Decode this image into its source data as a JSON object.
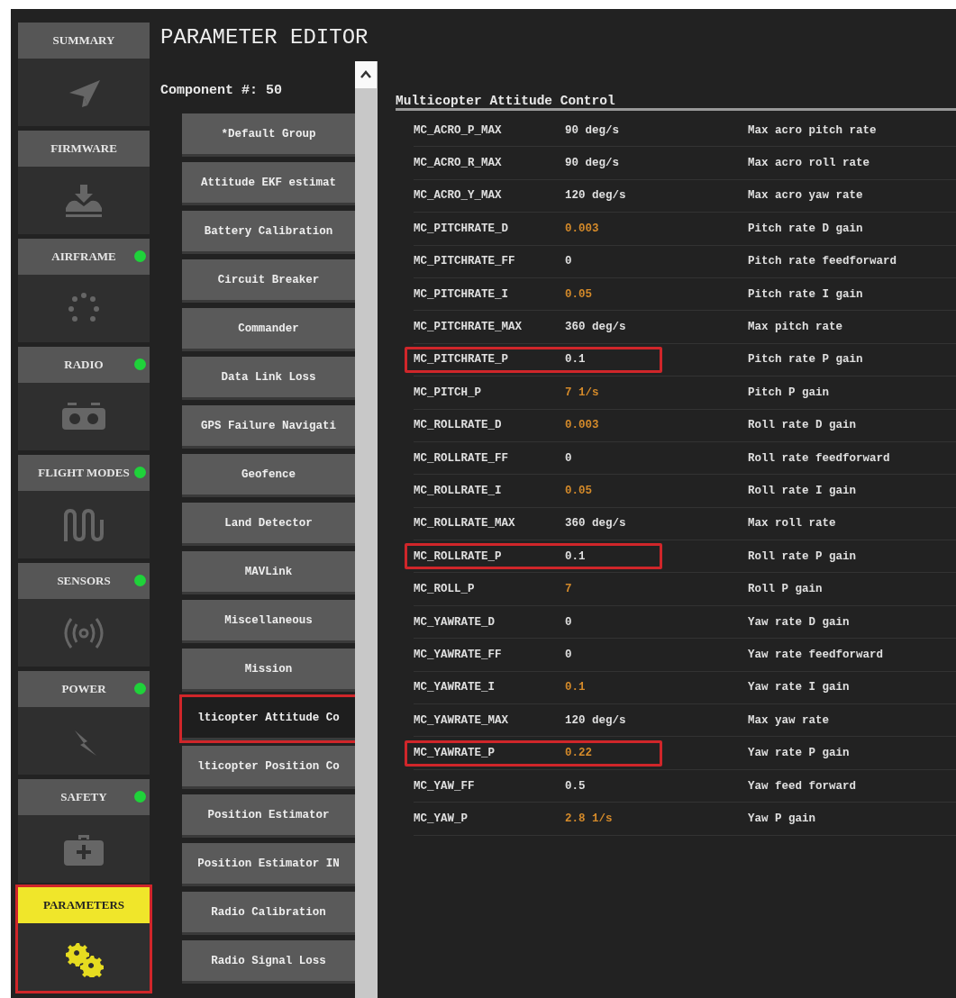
{
  "sidebar": {
    "items": [
      {
        "label": "SUMMARY",
        "status_dot": false,
        "selected": false,
        "highlighted": false
      },
      {
        "label": "FIRMWARE",
        "status_dot": false,
        "selected": false,
        "highlighted": false
      },
      {
        "label": "AIRFRAME",
        "status_dot": true,
        "selected": false,
        "highlighted": false
      },
      {
        "label": "RADIO",
        "status_dot": true,
        "selected": false,
        "highlighted": false
      },
      {
        "label": "FLIGHT MODES",
        "status_dot": true,
        "selected": false,
        "highlighted": false
      },
      {
        "label": "SENSORS",
        "status_dot": true,
        "selected": false,
        "highlighted": false
      },
      {
        "label": "POWER",
        "status_dot": true,
        "selected": false,
        "highlighted": false
      },
      {
        "label": "SAFETY",
        "status_dot": true,
        "selected": false,
        "highlighted": false
      },
      {
        "label": "PARAMETERS",
        "status_dot": false,
        "selected": true,
        "highlighted": true
      }
    ]
  },
  "title": "PARAMETER EDITOR",
  "component_label": "Component #: 50",
  "groups": [
    {
      "label": "*Default Group",
      "selected": false,
      "highlighted": false
    },
    {
      "label": "Attitude EKF estimat",
      "selected": false,
      "highlighted": false
    },
    {
      "label": "Battery Calibration",
      "selected": false,
      "highlighted": false
    },
    {
      "label": "Circuit Breaker",
      "selected": false,
      "highlighted": false
    },
    {
      "label": "Commander",
      "selected": false,
      "highlighted": false
    },
    {
      "label": "Data Link Loss",
      "selected": false,
      "highlighted": false
    },
    {
      "label": "GPS Failure Navigati",
      "selected": false,
      "highlighted": false
    },
    {
      "label": "Geofence",
      "selected": false,
      "highlighted": false
    },
    {
      "label": "Land Detector",
      "selected": false,
      "highlighted": false
    },
    {
      "label": "MAVLink",
      "selected": false,
      "highlighted": false
    },
    {
      "label": "Miscellaneous",
      "selected": false,
      "highlighted": false
    },
    {
      "label": "Mission",
      "selected": false,
      "highlighted": false
    },
    {
      "label": "lticopter Attitude Co",
      "selected": true,
      "highlighted": true
    },
    {
      "label": "lticopter Position Co",
      "selected": false,
      "highlighted": false
    },
    {
      "label": "Position Estimator",
      "selected": false,
      "highlighted": false
    },
    {
      "label": "Position Estimator IN",
      "selected": false,
      "highlighted": false
    },
    {
      "label": "Radio Calibration",
      "selected": false,
      "highlighted": false
    },
    {
      "label": "Radio Signal Loss",
      "selected": false,
      "highlighted": false
    }
  ],
  "table": {
    "heading": "Multicopter Attitude Control",
    "rows": [
      {
        "name": "MC_ACRO_P_MAX",
        "value": "90 deg/s",
        "description": "Max acro pitch rate",
        "modified": false,
        "highlighted": false
      },
      {
        "name": "MC_ACRO_R_MAX",
        "value": "90 deg/s",
        "description": "Max acro roll rate",
        "modified": false,
        "highlighted": false
      },
      {
        "name": "MC_ACRO_Y_MAX",
        "value": "120 deg/s",
        "description": "Max acro yaw rate",
        "modified": false,
        "highlighted": false
      },
      {
        "name": "MC_PITCHRATE_D",
        "value": "0.003",
        "description": "Pitch rate D gain",
        "modified": true,
        "highlighted": false
      },
      {
        "name": "MC_PITCHRATE_FF",
        "value": "0",
        "description": "Pitch rate feedforward",
        "modified": false,
        "highlighted": false
      },
      {
        "name": "MC_PITCHRATE_I",
        "value": "0.05",
        "description": "Pitch rate I gain",
        "modified": true,
        "highlighted": false
      },
      {
        "name": "MC_PITCHRATE_MAX",
        "value": "360 deg/s",
        "description": "Max pitch rate",
        "modified": false,
        "highlighted": false
      },
      {
        "name": "MC_PITCHRATE_P",
        "value": "0.1",
        "description": "Pitch rate P gain",
        "modified": false,
        "highlighted": true
      },
      {
        "name": "MC_PITCH_P",
        "value": "7 1/s",
        "description": "Pitch P gain",
        "modified": true,
        "highlighted": false
      },
      {
        "name": "MC_ROLLRATE_D",
        "value": "0.003",
        "description": "Roll rate D gain",
        "modified": true,
        "highlighted": false
      },
      {
        "name": "MC_ROLLRATE_FF",
        "value": "0",
        "description": "Roll rate feedforward",
        "modified": false,
        "highlighted": false
      },
      {
        "name": "MC_ROLLRATE_I",
        "value": "0.05",
        "description": "Roll rate I gain",
        "modified": true,
        "highlighted": false
      },
      {
        "name": "MC_ROLLRATE_MAX",
        "value": "360 deg/s",
        "description": "Max roll rate",
        "modified": false,
        "highlighted": false
      },
      {
        "name": "MC_ROLLRATE_P",
        "value": "0.1",
        "description": "Roll rate P gain",
        "modified": false,
        "highlighted": true
      },
      {
        "name": "MC_ROLL_P",
        "value": "7",
        "description": "Roll P gain",
        "modified": true,
        "highlighted": false
      },
      {
        "name": "MC_YAWRATE_D",
        "value": "0",
        "description": "Yaw rate D gain",
        "modified": false,
        "highlighted": false
      },
      {
        "name": "MC_YAWRATE_FF",
        "value": "0",
        "description": "Yaw rate feedforward",
        "modified": false,
        "highlighted": false
      },
      {
        "name": "MC_YAWRATE_I",
        "value": "0.1",
        "description": "Yaw rate I gain",
        "modified": true,
        "highlighted": false
      },
      {
        "name": "MC_YAWRATE_MAX",
        "value": "120 deg/s",
        "description": "Max yaw rate",
        "modified": false,
        "highlighted": false
      },
      {
        "name": "MC_YAWRATE_P",
        "value": "0.22",
        "description": "Yaw rate P gain",
        "modified": true,
        "highlighted": true
      },
      {
        "name": "MC_YAW_FF",
        "value": "0.5",
        "description": "Yaw feed forward",
        "modified": false,
        "highlighted": false
      },
      {
        "name": "MC_YAW_P",
        "value": "2.8 1/s",
        "description": "Yaw P gain",
        "modified": true,
        "highlighted": false
      }
    ]
  }
}
